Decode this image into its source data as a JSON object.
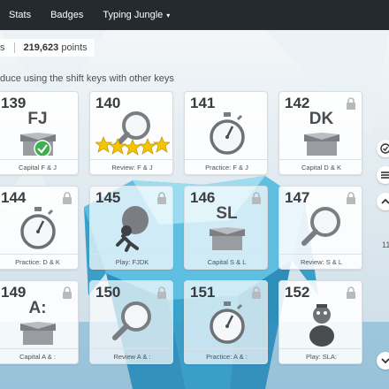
{
  "nav": {
    "items": [
      {
        "label": "Stats"
      },
      {
        "label": "Badges"
      },
      {
        "label": "Typing Jungle",
        "caret": "▾"
      }
    ]
  },
  "stats": {
    "left_fragment": "s",
    "points": "219,623",
    "points_suffix": "points"
  },
  "lesson": {
    "subtitle": "duce using the shift keys with other keys"
  },
  "cards": [
    {
      "number": "139",
      "icon": "box-icon",
      "letters": "FJ",
      "completed": true,
      "locked": false,
      "label": "Capital F & J"
    },
    {
      "number": "140",
      "icon": "magnifier-icon",
      "stars": 5,
      "locked": false,
      "label": "Review: F & J"
    },
    {
      "number": "141",
      "icon": "stopwatch-icon",
      "locked": false,
      "label": "Practice: F & J"
    },
    {
      "number": "142",
      "icon": "box-icon",
      "letters": "DK",
      "locked": true,
      "label": "Capital D & K"
    },
    {
      "number": "144",
      "icon": "stopwatch-icon",
      "locked": true,
      "label": "Practice: D & K"
    },
    {
      "number": "145",
      "icon": "boulder-game-icon",
      "locked": true,
      "label": "Play: FJDK"
    },
    {
      "number": "146",
      "icon": "box-icon",
      "letters": "SL",
      "locked": true,
      "label": "Capital S & L"
    },
    {
      "number": "147",
      "icon": "magnifier-icon",
      "locked": true,
      "label": "Review: S & L"
    },
    {
      "number": "149",
      "icon": "box-icon",
      "letters": "A:",
      "locked": true,
      "label": "Capital A & :"
    },
    {
      "number": "150",
      "icon": "magnifier-icon",
      "locked": true,
      "label": "Review A & :"
    },
    {
      "number": "151",
      "icon": "stopwatch-icon",
      "locked": true,
      "label": "Practice: A & :"
    },
    {
      "number": "152",
      "icon": "character-game-icon",
      "locked": true,
      "label": "Play: SLA:"
    }
  ],
  "rail": {
    "buttons": [
      {
        "icon": "check-circle-icon"
      },
      {
        "icon": "menu-icon"
      },
      {
        "icon": "chevron-up-icon"
      },
      {
        "icon": "chevron-down-icon"
      }
    ],
    "page_text": "11"
  },
  "colors": {
    "nav_bg": "#252a31",
    "check_green": "#3cb04a",
    "star_gold": "#f5c400",
    "iceberg": "#4fb3d9"
  }
}
